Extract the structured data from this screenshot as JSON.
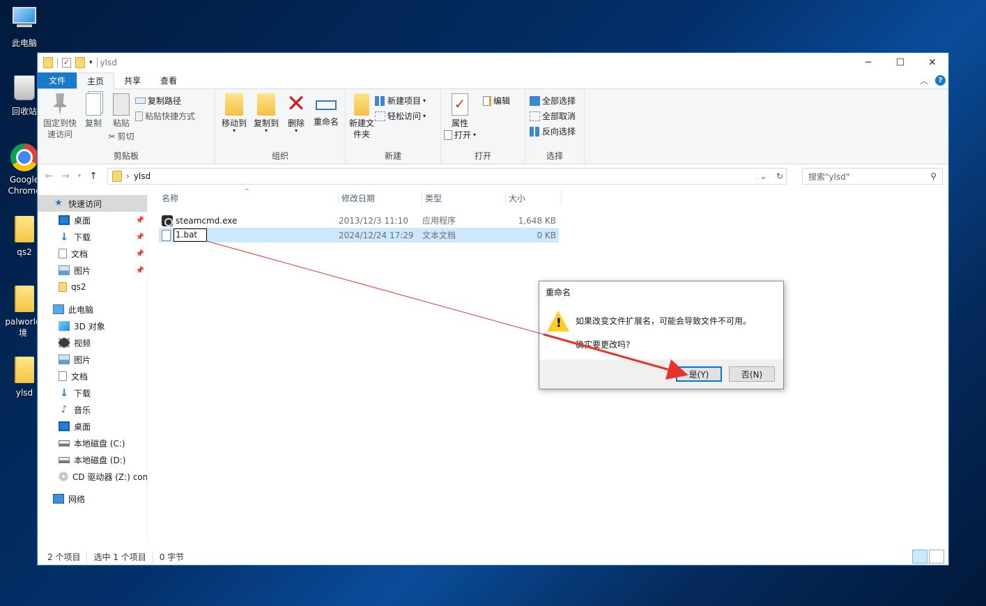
{
  "desktop": {
    "icons": [
      {
        "label": "此电脑"
      },
      {
        "label": "回收站"
      },
      {
        "label": "Google Chrome"
      },
      {
        "label": "qs2"
      },
      {
        "label": "palworld 境"
      },
      {
        "label": "ylsd"
      }
    ]
  },
  "window": {
    "title": "ylsd",
    "tabs": [
      "文件",
      "主页",
      "共享",
      "查看"
    ],
    "ribbon": {
      "clipboard": {
        "label": "剪贴板",
        "pin": "固定到快速访问",
        "copy": "复制",
        "paste": "粘贴",
        "copy_path": "复制路径",
        "paste_shortcut": "粘贴快捷方式",
        "cut": "剪切"
      },
      "organize": {
        "label": "组织",
        "move_to": "移动到",
        "copy_to": "复制到",
        "delete": "删除",
        "rename": "重命名"
      },
      "new": {
        "label": "新建",
        "new_folder": "新建文件夹",
        "new_item": "新建项目",
        "easy_access": "轻松访问"
      },
      "open": {
        "label": "打开",
        "properties": "属性",
        "open": "打开",
        "edit": "编辑"
      },
      "select": {
        "label": "选择",
        "select_all": "全部选择",
        "select_none": "全部取消",
        "invert": "反向选择"
      }
    },
    "address": {
      "path": "ylsd",
      "search_placeholder": "搜索\"ylsd\""
    },
    "nav": {
      "quick_access": "快速访问",
      "qa_items": [
        "桌面",
        "下载",
        "文档",
        "图片",
        "qs2"
      ],
      "this_pc": "此电脑",
      "pc_items": [
        "3D 对象",
        "视频",
        "图片",
        "文档",
        "下载",
        "音乐",
        "桌面",
        "本地磁盘 (C:)",
        "本地磁盘 (D:)",
        "CD 驱动器 (Z:) con"
      ],
      "network": "网络"
    },
    "columns": [
      "名称",
      "修改日期",
      "类型",
      "大小"
    ],
    "files": [
      {
        "name": "steamcmd.exe",
        "date": "2013/12/3 11:10",
        "type": "应用程序",
        "size": "1,648 KB"
      },
      {
        "name": "1.bat",
        "date": "2024/12/24 17:29",
        "type": "文本文档",
        "size": "0 KB"
      }
    ],
    "status": {
      "count": "2 个项目",
      "selected": "选中 1 个项目",
      "bytes": "0 字节"
    }
  },
  "dialog": {
    "title": "重命名",
    "message": "如果改变文件扩展名，可能会导致文件不可用。",
    "question": "确实要更改吗?",
    "yes": "是(Y)",
    "no": "否(N)"
  },
  "colors": {
    "accent": "#1979ca",
    "selection": "#cce8ff",
    "annotation_arrow": "#e8322b"
  }
}
